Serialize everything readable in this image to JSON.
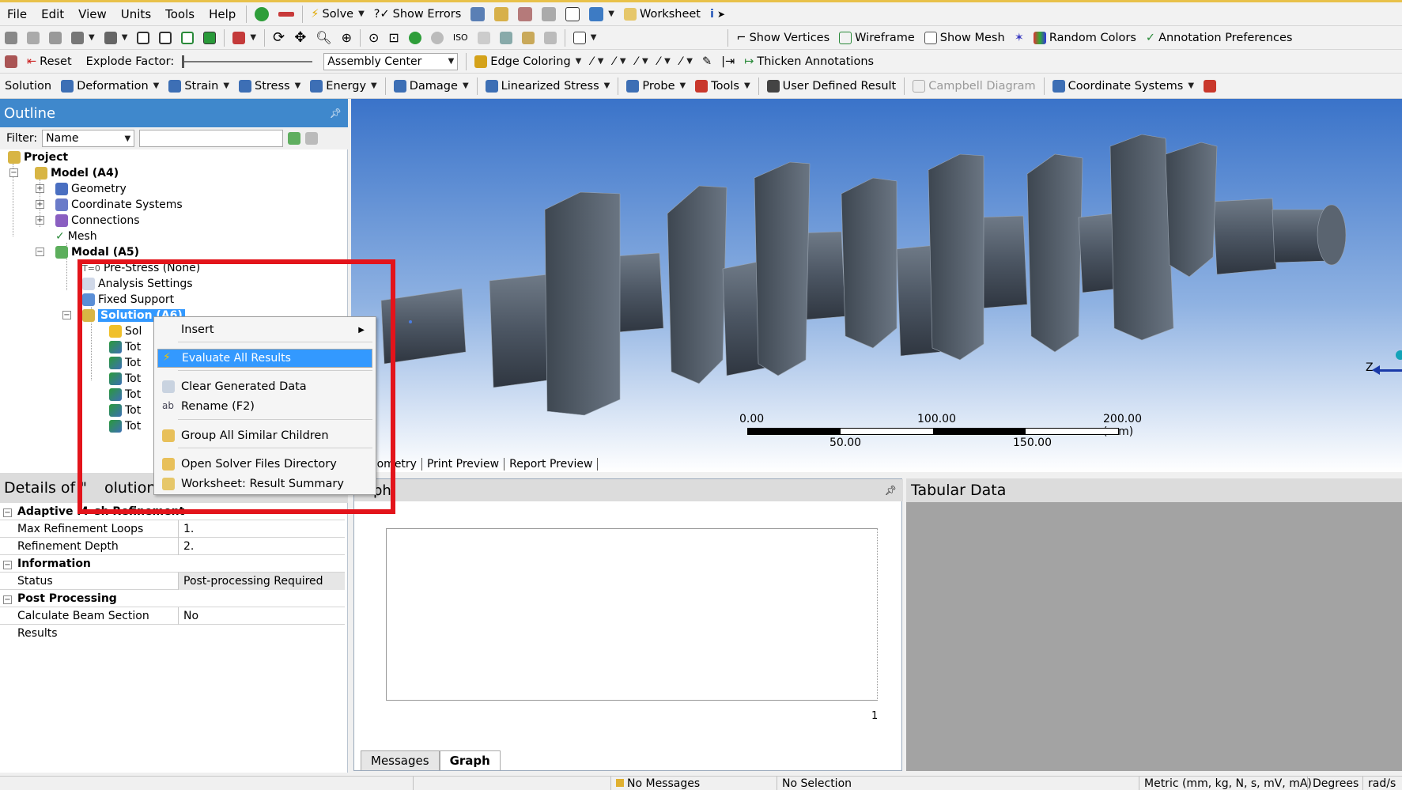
{
  "menubar": {
    "menus": [
      "File",
      "Edit",
      "View",
      "Units",
      "Tools",
      "Help"
    ],
    "solve_label": "Solve",
    "show_errors_label": "Show Errors",
    "worksheet_label": "Worksheet"
  },
  "toolbar2": {
    "show_vertices_label": "Show Vertices",
    "wireframe_label": "Wireframe",
    "show_mesh_label": "Show Mesh",
    "random_colors_label": "Random Colors",
    "annotation_prefs_label": "Annotation Preferences"
  },
  "toolbar3": {
    "reset_label": "Reset",
    "explode_factor_label": "Explode Factor:",
    "assembly_center_value": "Assembly Center",
    "edge_coloring_label": "Edge Coloring",
    "thicken_annotations_label": "Thicken Annotations"
  },
  "toolbar4": {
    "solution_label": "Solution",
    "deformation_label": "Deformation",
    "strain_label": "Strain",
    "stress_label": "Stress",
    "energy_label": "Energy",
    "damage_label": "Damage",
    "linearized_stress_label": "Linearized Stress",
    "probe_label": "Probe",
    "tools_label": "Tools",
    "user_defined_result_label": "User Defined Result",
    "campbell_diagram_label": "Campbell Diagram",
    "coordinate_systems_label": "Coordinate Systems"
  },
  "outline": {
    "title": "Outline",
    "filter_label": "Filter:",
    "filter_value": "Name",
    "tree": {
      "project": "Project",
      "model": "Model (A4)",
      "geometry": "Geometry",
      "coordinate_systems": "Coordinate Systems",
      "connections": "Connections",
      "mesh": "Mesh",
      "modal": "Modal (A5)",
      "pre_stress": "Pre-Stress (None)",
      "analysis_settings": "Analysis Settings",
      "fixed_support": "Fixed Support",
      "solution": "Solution (A6)",
      "solution_info_trunc": "Sol",
      "total_trunc": "Tot"
    }
  },
  "context_menu": {
    "insert": "Insert",
    "evaluate_all": "Evaluate All Results",
    "clear_generated": "Clear Generated Data",
    "rename": "Rename (F2)",
    "group_similar": "Group All Similar Children",
    "open_solver_dir": "Open Solver Files Directory",
    "worksheet_summary": "Worksheet: Result Summary"
  },
  "details": {
    "title": "Details of \"Solution (A6)\"",
    "title_visible_prefix": "Details of \"",
    "title_visible_suffix": "olution (A(",
    "groups": {
      "adaptive": "Adaptive Mesh Refinement",
      "adaptive_visible": "Adaptive M",
      "adaptive_tail": "sh Refinement",
      "information": "Information",
      "post_processing": "Post Processing"
    },
    "rows": {
      "max_refinement_loops": {
        "k": "Max Refinement Loops",
        "v": "1."
      },
      "refinement_depth": {
        "k": "Refinement Depth",
        "v": "2."
      },
      "status": {
        "k": "Status",
        "v": "Post-processing Required"
      },
      "calc_beam": {
        "k": "Calculate Beam Section Results",
        "v": "No"
      }
    }
  },
  "viewport": {
    "scale_labels_top": [
      "0.00",
      "100.00",
      "200.00 (mm)"
    ],
    "scale_labels_bottom": [
      "50.00",
      "150.00"
    ],
    "tabs": [
      "eometry",
      "Print Preview",
      "Report Preview"
    ],
    "axis_label": "Z"
  },
  "graph": {
    "title_visible": "ph",
    "x_tick": "1",
    "tabs": [
      "Messages",
      "Graph"
    ]
  },
  "tabular": {
    "title": "Tabular Data"
  },
  "status": {
    "messages": "No Messages",
    "selection": "No Selection",
    "units": "Metric (mm, kg, N, s, mV, mA)",
    "angle": "Degrees",
    "rate": "rad/s"
  },
  "colors": {
    "panel_title_bg": "#3f88cc",
    "highlight": "#3399ff",
    "callout_red": "#e3141b",
    "part_gray": "#5b6673"
  }
}
